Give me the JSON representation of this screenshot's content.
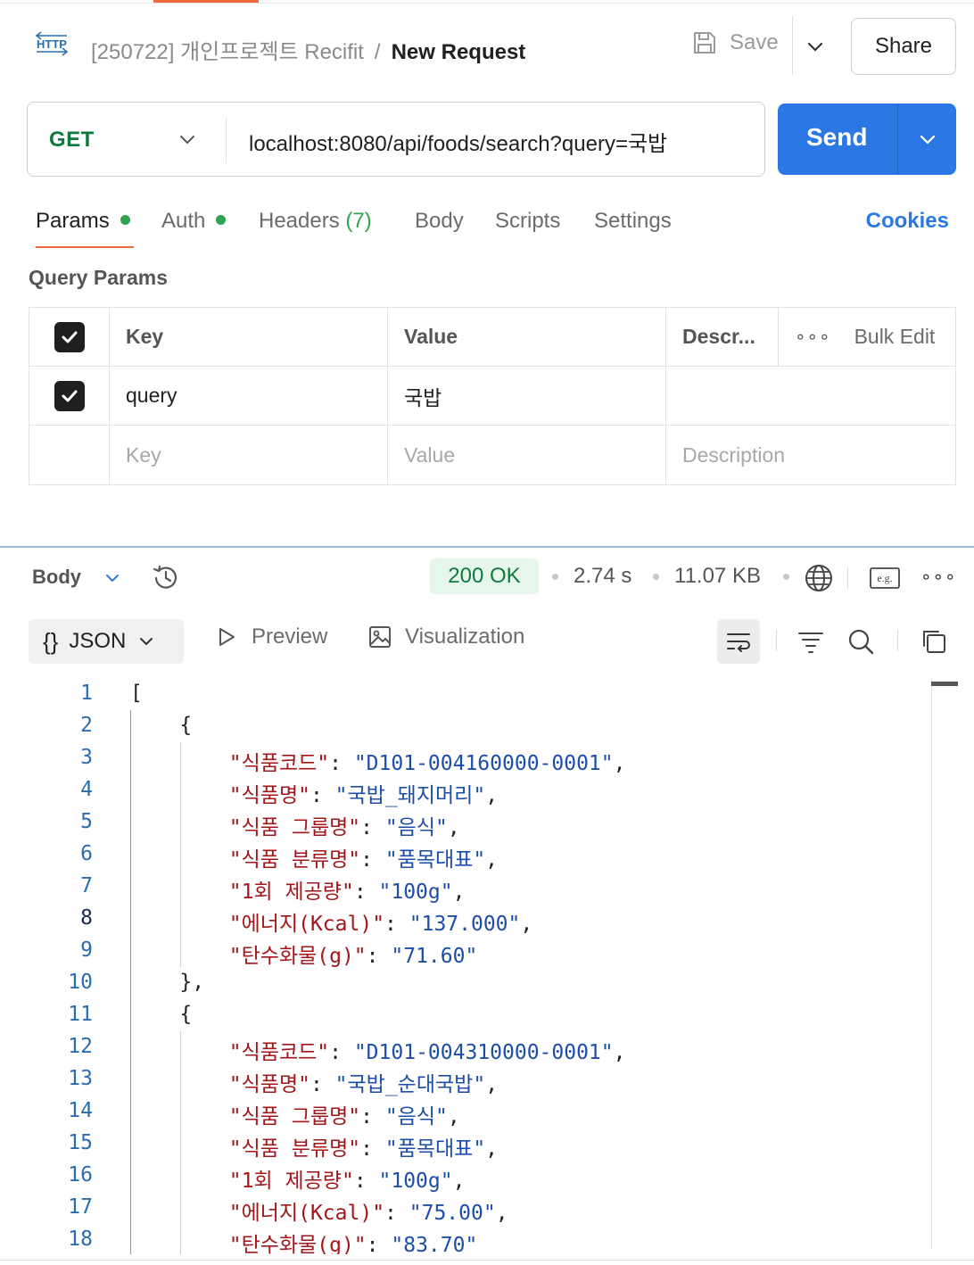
{
  "header": {
    "http_badge": "HTTP",
    "collection": "[250722] 개인프로젝트 Recifit",
    "separator": "/",
    "request_name": "New Request",
    "save_label": "Save",
    "share_label": "Share"
  },
  "request": {
    "method": "GET",
    "url": "localhost:8080/api/foods/search?query=국밥",
    "send_label": "Send"
  },
  "tabs": {
    "params": "Params",
    "auth": "Auth",
    "headers": "Headers",
    "headers_count": "(7)",
    "body": "Body",
    "scripts": "Scripts",
    "settings": "Settings",
    "cookies": "Cookies"
  },
  "query_params": {
    "title": "Query Params",
    "headers": {
      "key": "Key",
      "value": "Value",
      "description": "Descr...",
      "bulk_edit": "Bulk Edit"
    },
    "rows": [
      {
        "key": "query",
        "value": "국밥",
        "enabled": true
      }
    ],
    "placeholder": {
      "key": "Key",
      "value": "Value",
      "description": "Description"
    }
  },
  "response": {
    "body_label": "Body",
    "status": "200 OK",
    "time": "2.74 s",
    "size": "11.07 KB",
    "format": "JSON",
    "preview_label": "Preview",
    "visualization_label": "Visualization",
    "lines": [
      {
        "n": "1",
        "t": "["
      },
      {
        "n": "2",
        "t": "    {"
      },
      {
        "n": "3",
        "k": "\"식품코드\"",
        "v": "\"D101-004160000-0001\"",
        "c": ","
      },
      {
        "n": "4",
        "k": "\"식품명\"",
        "v": "\"국밥_돼지머리\"",
        "c": ","
      },
      {
        "n": "5",
        "k": "\"식품 그룹명\"",
        "v": "\"음식\"",
        "c": ","
      },
      {
        "n": "6",
        "k": "\"식품 분류명\"",
        "v": "\"품목대표\"",
        "c": ","
      },
      {
        "n": "7",
        "k": "\"1회 제공량\"",
        "v": "\"100g\"",
        "c": ","
      },
      {
        "n": "8",
        "k": "\"에너지(Kcal)\"",
        "v": "\"137.000\"",
        "c": ","
      },
      {
        "n": "9",
        "k": "\"탄수화물(g)\"",
        "v": "\"71.60\"",
        "c": ""
      },
      {
        "n": "10",
        "t": "    },"
      },
      {
        "n": "11",
        "t": "    {"
      },
      {
        "n": "12",
        "k": "\"식품코드\"",
        "v": "\"D101-004310000-0001\"",
        "c": ","
      },
      {
        "n": "13",
        "k": "\"식품명\"",
        "v": "\"국밥_순대국밥\"",
        "c": ","
      },
      {
        "n": "14",
        "k": "\"식품 그룹명\"",
        "v": "\"음식\"",
        "c": ","
      },
      {
        "n": "15",
        "k": "\"식품 분류명\"",
        "v": "\"품목대표\"",
        "c": ","
      },
      {
        "n": "16",
        "k": "\"1회 제공량\"",
        "v": "\"100g\"",
        "c": ","
      },
      {
        "n": "17",
        "k": "\"에너지(Kcal)\"",
        "v": "\"75.00\"",
        "c": ","
      },
      {
        "n": "18",
        "k": "\"탄수화물(g)\"",
        "v": "\"83.70\"",
        "c": ""
      }
    ]
  },
  "colors": {
    "accent": "#f26b3a",
    "send": "#2b78e4",
    "status_ok": "#0f7a3e",
    "json_key": "#a3161a",
    "json_string": "#1d4ea7"
  }
}
